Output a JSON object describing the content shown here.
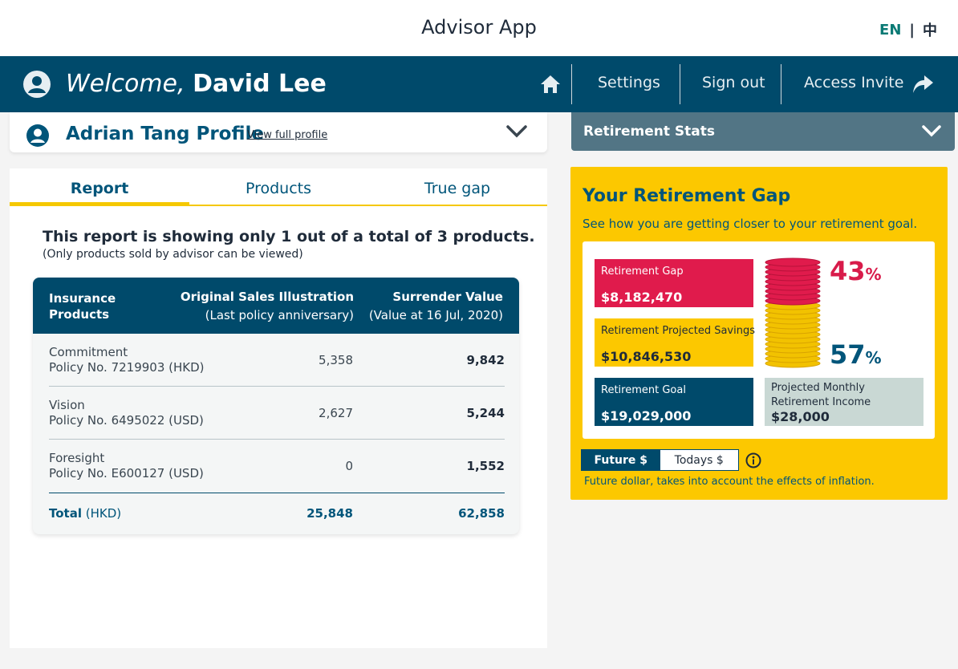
{
  "header": {
    "app_title": "Advisor App",
    "lang_en": "EN",
    "lang_sep": "|",
    "lang_zh": "中"
  },
  "nav": {
    "welcome_prefix": "Welcome,",
    "user_name": "David Lee",
    "settings": "Settings",
    "sign_out": "Sign out",
    "access_invite": "Access Invite"
  },
  "profile": {
    "name": "Adrian Tang Profile",
    "view_link": "View full profile"
  },
  "tabs": [
    {
      "label": "Report",
      "active": true
    },
    {
      "label": "Products",
      "active": false
    },
    {
      "label": "True gap",
      "active": false
    }
  ],
  "report": {
    "message": "This report is showing only 1 out of a total of 3 products.",
    "sub_message": "(Only products sold by advisor can be viewed)",
    "columns": {
      "c1": "Insurance Products",
      "c2_title": "Original Sales Illustration",
      "c2_sub": "(Last policy anniversary)",
      "c3_title": "Surrender Value",
      "c3_sub": "(Value at 16 Jul, 2020)"
    },
    "rows": [
      {
        "product": "Commitment",
        "policy": "Policy No. 7219903 (HKD)",
        "osi": "5,358",
        "sv": "9,842"
      },
      {
        "product": "Vision",
        "policy": "Policy No. 6495022 (USD)",
        "osi": "2,627",
        "sv": "5,244"
      },
      {
        "product": "Foresight",
        "policy": "Policy No. E600127 (USD)",
        "osi": "0",
        "sv": "1,552"
      }
    ],
    "total": {
      "label": "Total",
      "currency": "(HKD)",
      "osi": "25,848",
      "sv": "62,858"
    }
  },
  "stats": {
    "title": "Retirement Stats"
  },
  "gap": {
    "title": "Your Retirement Gap",
    "subtitle": "See how you are getting closer to your retirement goal.",
    "gap_label": "Retirement Gap",
    "gap_value": "$8,182,470",
    "savings_label": "Retirement Projected Savings",
    "savings_value": "$10,846,530",
    "goal_label": "Retirement Goal",
    "goal_value": "$19,029,000",
    "income_label": "Projected Monthly Retirement Income",
    "income_value": "$28,000",
    "gap_pct": "43",
    "savings_pct": "57",
    "pct_sign": "%",
    "toggle_future": "Future $",
    "toggle_today": "Todays $",
    "note": "Future dollar, takes into account the effects of inflation."
  },
  "colors": {
    "navy": "#004a6b",
    "yellow": "#fcc800",
    "red": "#e01b4c",
    "slate": "#527585",
    "teal_accent": "#0b7a75"
  }
}
